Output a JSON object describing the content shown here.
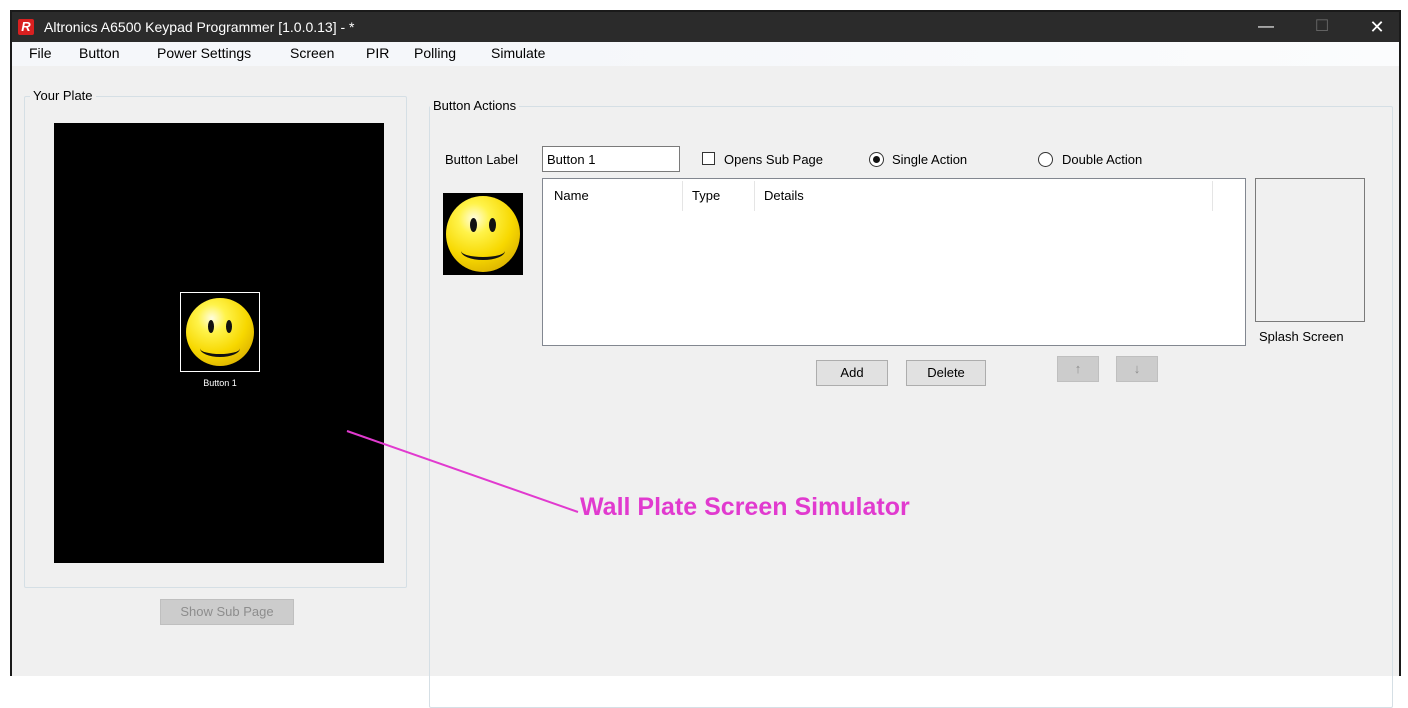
{
  "window": {
    "title": "Altronics A6500 Keypad Programmer [1.0.0.13]  - *",
    "logo_letter": "R",
    "minimize_glyph": "—",
    "maximize_glyph": "☐",
    "close_glyph": "✕"
  },
  "menu": {
    "items": [
      "File",
      "Button",
      "Power Settings",
      "Screen",
      "PIR",
      "Polling",
      "Simulate"
    ]
  },
  "your_plate": {
    "legend": "Your Plate",
    "button_caption": "Button 1",
    "show_sub_page_label": "Show Sub Page"
  },
  "button_actions": {
    "legend": "Button Actions",
    "button_label_caption": "Button Label",
    "button_label_value": "Button 1",
    "opens_sub_page_label": "Opens Sub Page",
    "opens_sub_page_checked": false,
    "single_action_label": "Single Action",
    "double_action_label": "Double Action",
    "selected_action": "Single Action",
    "columns": [
      "Name",
      "Type",
      "Details"
    ],
    "add_label": "Add",
    "delete_label": "Delete",
    "move_up_glyph": "↑",
    "move_down_glyph": "↓",
    "splash_screen_label": "Splash Screen"
  },
  "annotation": {
    "text": "Wall Plate Screen Simulator",
    "color": "#e13acf"
  },
  "colors": {
    "titlebar": "#2b2b2b",
    "window_bg": "#f0f0f0",
    "plate_screen": "#000000",
    "logo": "#d92020"
  },
  "icons": [
    "app-logo-icon",
    "smiley-icon",
    "arrow-up-icon",
    "arrow-down-icon"
  ]
}
